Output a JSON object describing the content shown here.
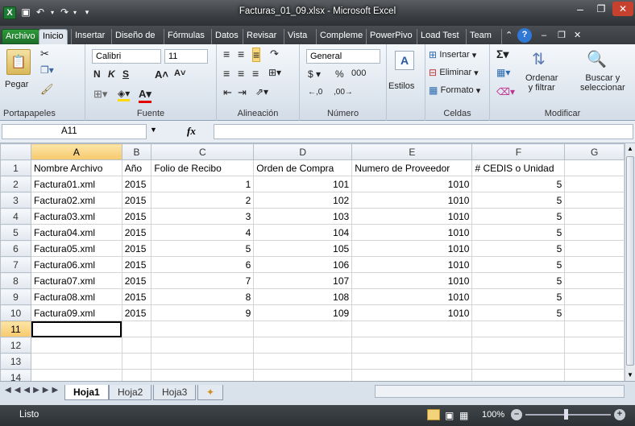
{
  "window": {
    "title": "Facturas_01_09.xlsx  -  Microsoft Excel"
  },
  "tabs": [
    "Archivo",
    "Inicio",
    "Insertar",
    "Diseño de",
    "Fórmulas",
    "Datos",
    "Revisar",
    "Vista",
    "Compleme",
    "PowerPivo",
    "Load Test",
    "Team"
  ],
  "ribbon": {
    "clipboard": {
      "label": "Portapapeles",
      "paste": "Pegar"
    },
    "font": {
      "label": "Fuente",
      "name": "Calibri",
      "size": "11"
    },
    "alignment": {
      "label": "Alineación"
    },
    "number": {
      "label": "Número",
      "format": "General"
    },
    "styles": {
      "label": "Estilos"
    },
    "cells": {
      "label": "Celdas",
      "insert": "Insertar",
      "delete": "Eliminar",
      "format": "Formato"
    },
    "editing": {
      "label": "Modificar",
      "sort": "Ordenar",
      "sort2": "y filtrar",
      "find": "Buscar y",
      "find2": "seleccionar"
    }
  },
  "formula_bar": {
    "name_box": "A11",
    "fx": "fx",
    "value": ""
  },
  "grid": {
    "columns": [
      "A",
      "B",
      "C",
      "D",
      "E",
      "F",
      "G"
    ],
    "headers": [
      "Nombre Archivo",
      "Año",
      "Folio de Recibo",
      "Orden de Compra",
      "Numero de Proveedor",
      "# CEDIS o Unidad"
    ],
    "rows": [
      [
        "Factura01.xml",
        "2015",
        "1",
        "101",
        "1010",
        "5"
      ],
      [
        "Factura02.xml",
        "2015",
        "2",
        "102",
        "1010",
        "5"
      ],
      [
        "Factura03.xml",
        "2015",
        "3",
        "103",
        "1010",
        "5"
      ],
      [
        "Factura04.xml",
        "2015",
        "4",
        "104",
        "1010",
        "5"
      ],
      [
        "Factura05.xml",
        "2015",
        "5",
        "105",
        "1010",
        "5"
      ],
      [
        "Factura06.xml",
        "2015",
        "6",
        "106",
        "1010",
        "5"
      ],
      [
        "Factura07.xml",
        "2015",
        "7",
        "107",
        "1010",
        "5"
      ],
      [
        "Factura08.xml",
        "2015",
        "8",
        "108",
        "1010",
        "5"
      ],
      [
        "Factura09.xml",
        "2015",
        "9",
        "109",
        "1010",
        "5"
      ]
    ],
    "row_numbers": [
      "1",
      "2",
      "3",
      "4",
      "5",
      "6",
      "7",
      "8",
      "9",
      "10",
      "11",
      "12",
      "13",
      "14"
    ],
    "active_row": "11"
  },
  "sheets": [
    "Hoja1",
    "Hoja2",
    "Hoja3"
  ],
  "status": {
    "text": "Listo",
    "zoom": "100%"
  }
}
